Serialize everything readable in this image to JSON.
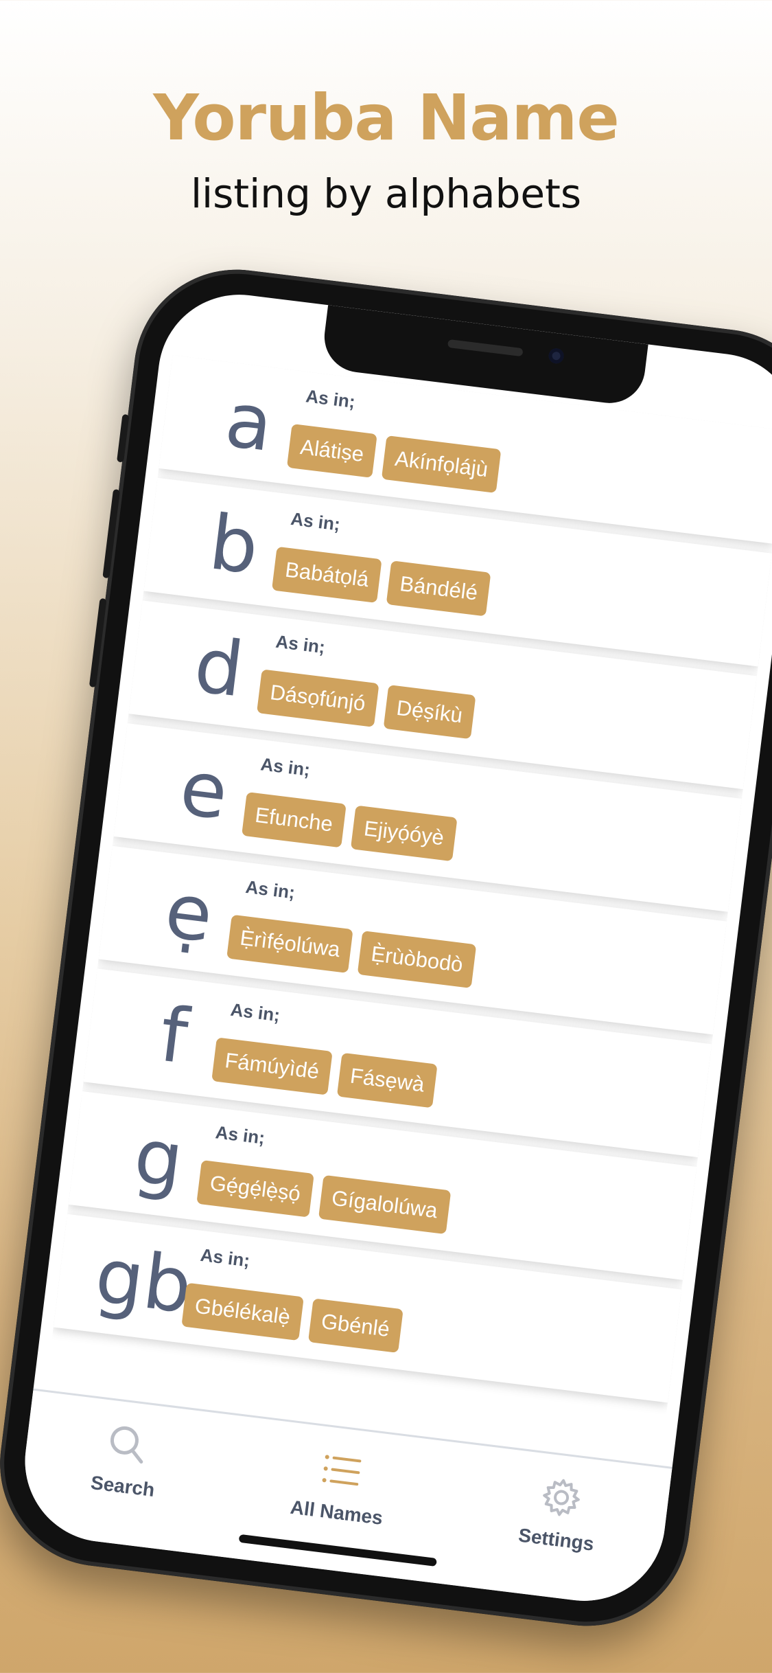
{
  "hero": {
    "title": "Yoruba Name",
    "subtitle": "listing by alphabets"
  },
  "list": {
    "prefix": "As in;",
    "rows": [
      {
        "letter": "a",
        "names": [
          "Alátiṣe",
          "Akínfọlájù"
        ]
      },
      {
        "letter": "b",
        "names": [
          "Babátọlá",
          "Bándélé"
        ]
      },
      {
        "letter": "d",
        "names": [
          "Dásọfúnjó",
          "Dẹ́ṣíkù"
        ]
      },
      {
        "letter": "e",
        "names": [
          "Efunche",
          "Ejiyọ́óyè"
        ]
      },
      {
        "letter": "ẹ",
        "names": [
          "Ẹ̀rìfẹ́olúwa",
          "Ẹ̀rùòbodò"
        ]
      },
      {
        "letter": "f",
        "names": [
          "Fámúyìdé",
          "Fásẹwà"
        ]
      },
      {
        "letter": "g",
        "names": [
          "Gẹ́gẹ́lẹ̀ṣọ́",
          "Gígalolúwa"
        ]
      },
      {
        "letter": "gb",
        "names": [
          "Gbélékalẹ̀",
          "Gbénlé"
        ]
      }
    ]
  },
  "tabbar": {
    "tabs": [
      {
        "label": "Search",
        "icon": "search-icon"
      },
      {
        "label": "All Names",
        "icon": "list-icon"
      },
      {
        "label": "Settings",
        "icon": "gear-icon"
      }
    ]
  },
  "colors": {
    "accent": "#cfa25d",
    "letter": "#56617a"
  }
}
